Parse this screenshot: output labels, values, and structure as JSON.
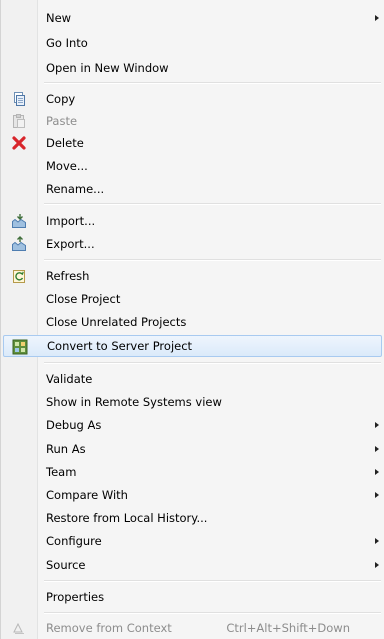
{
  "menu": {
    "items": [
      {
        "label": "New",
        "submenu": true
      },
      {
        "label": "Go Into"
      },
      {
        "label": "Open in New Window"
      },
      {
        "label": "Copy",
        "icon": "copy-icon"
      },
      {
        "label": "Paste",
        "icon": "paste-icon",
        "disabled": true
      },
      {
        "label": "Delete",
        "icon": "delete-icon"
      },
      {
        "label": "Move..."
      },
      {
        "label": "Rename..."
      },
      {
        "label": "Import...",
        "icon": "import-icon"
      },
      {
        "label": "Export...",
        "icon": "export-icon"
      },
      {
        "label": "Refresh",
        "icon": "refresh-icon"
      },
      {
        "label": "Close Project"
      },
      {
        "label": "Close Unrelated Projects"
      },
      {
        "label": "Convert to Server Project",
        "icon": "convert-server-icon",
        "selected": true
      },
      {
        "label": "Validate"
      },
      {
        "label": "Show in Remote Systems view"
      },
      {
        "label": "Debug As",
        "submenu": true
      },
      {
        "label": "Run As",
        "submenu": true
      },
      {
        "label": "Team",
        "submenu": true
      },
      {
        "label": "Compare With",
        "submenu": true
      },
      {
        "label": "Restore from Local History..."
      },
      {
        "label": "Configure",
        "submenu": true
      },
      {
        "label": "Source",
        "submenu": true
      },
      {
        "label": "Properties"
      },
      {
        "label": "Remove from Context",
        "icon": "remove-context-icon",
        "disabled": true,
        "shortcut": "Ctrl+Alt+Shift+Down"
      }
    ]
  },
  "colors": {
    "selection_border": "#a8caf0",
    "selection_fill": "#dbeafa",
    "disabled_text": "#8d8d8d",
    "delete_icon": "#d8252b"
  }
}
